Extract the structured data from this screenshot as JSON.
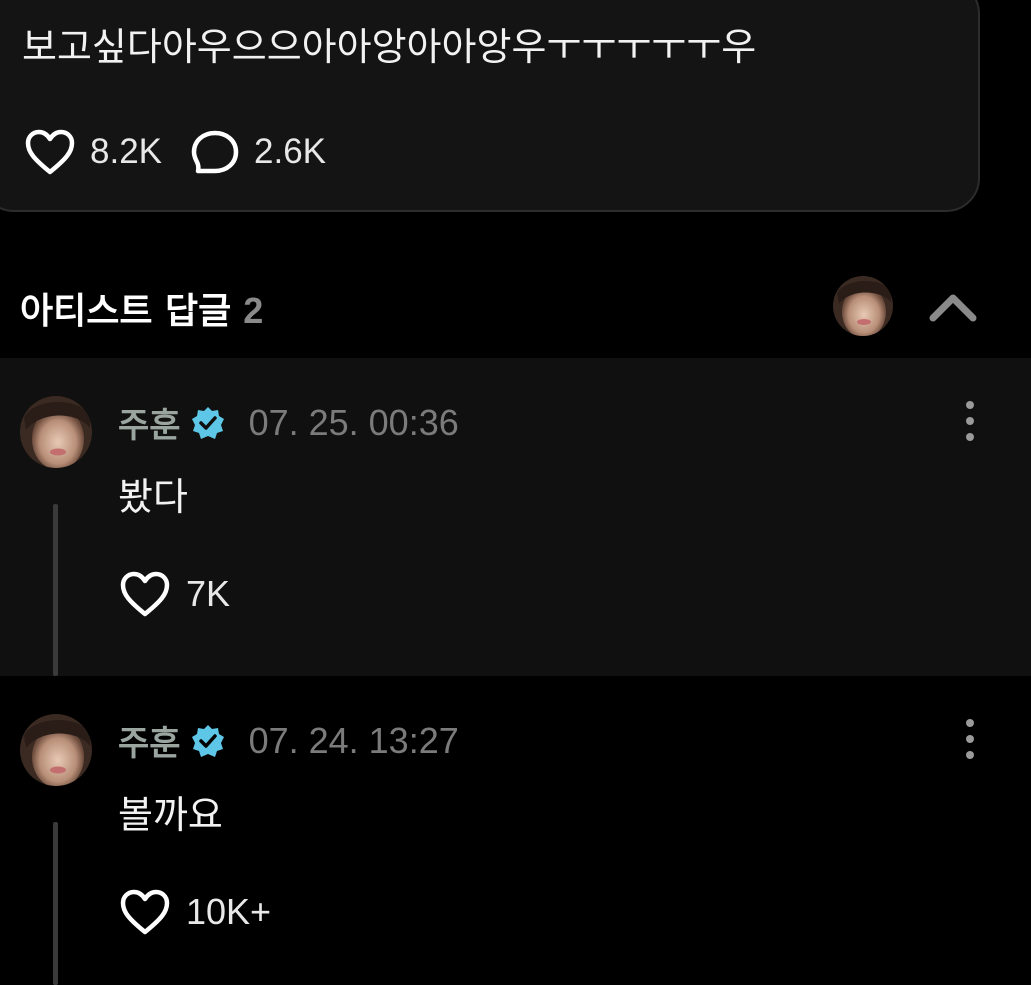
{
  "post": {
    "text": "보고싶다아우으으아아앙아아앙우ㅜㅜㅜㅜㅜ우",
    "like_count": "8.2K",
    "comment_count": "2.6K"
  },
  "artist_replies": {
    "title": "아티스트 답글",
    "count": "2"
  },
  "replies": [
    {
      "author": "주훈",
      "date": "07. 25. 00:36",
      "text": "봤다",
      "like_count": "7K"
    },
    {
      "author": "주훈",
      "date": "07. 24. 13:27",
      "text": "볼까요",
      "like_count": "10K+"
    }
  ],
  "colors": {
    "verified_badge": "#5ec6e6",
    "author_name": "#9aa5a0",
    "date": "#7b7b7b",
    "count_grey": "#8a8a8a"
  },
  "icons": {
    "like": "heart-icon",
    "comment": "speech-bubble-icon",
    "verified": "verified-badge-icon",
    "more": "vertical-dots-icon",
    "collapse": "chevron-up-icon"
  }
}
